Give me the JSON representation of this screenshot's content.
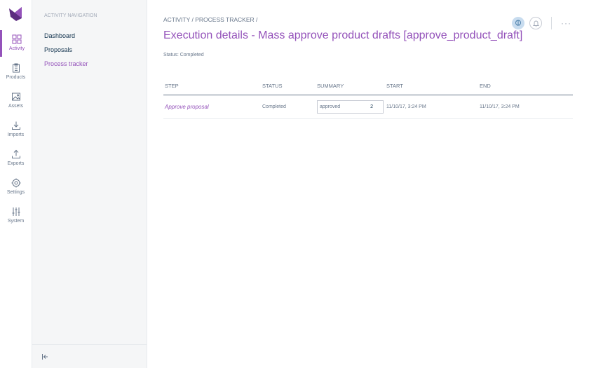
{
  "main_menu": [
    {
      "label": "Activity",
      "icon": "grid-icon",
      "active": true
    },
    {
      "label": "Products",
      "icon": "clipboard-icon",
      "active": false
    },
    {
      "label": "Assets",
      "icon": "image-icon",
      "active": false
    },
    {
      "label": "Imports",
      "icon": "download-icon",
      "active": false
    },
    {
      "label": "Exports",
      "icon": "upload-icon",
      "active": false
    },
    {
      "label": "Settings",
      "icon": "gear-icon",
      "active": false
    },
    {
      "label": "System",
      "icon": "sliders-icon",
      "active": false
    }
  ],
  "sub_nav": {
    "title": "ACTIVITY NAVIGATION",
    "items": [
      "Dashboard",
      "Proposals",
      "Process tracker"
    ],
    "active_item": "Process tracker"
  },
  "breadcrumb": {
    "part1": "ACTIVITY",
    "separator": "/",
    "part2": "PROCESS TRACKER"
  },
  "page": {
    "title": "Execution details - Mass approve product drafts [approve_product_draft]",
    "status": "Status: Completed"
  },
  "header_actions": {
    "more_label": "···"
  },
  "table": {
    "columns": [
      "STEP",
      "STATUS",
      "SUMMARY",
      "START",
      "END"
    ],
    "rows": [
      {
        "step": "Approve proposal",
        "status": "Completed",
        "summary_key": "approved",
        "summary_value": "2",
        "start": "11/10/17, 3:24 PM",
        "end": "11/10/17, 3:24 PM"
      }
    ]
  },
  "colors": {
    "accent": "#9452ba",
    "text": "#67768a",
    "help_badge": "#c8dcef"
  }
}
